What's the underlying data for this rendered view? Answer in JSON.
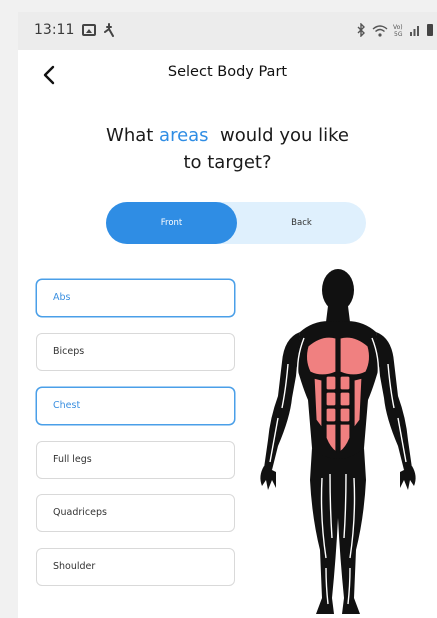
{
  "status_bar": {
    "time": "13:11",
    "left_icons": [
      "gallery-icon",
      "activity-icon"
    ],
    "right_icons": [
      "bluetooth-icon",
      "wifi-icon",
      "volte-icon",
      "signal-icon",
      "battery-icon"
    ],
    "volte_text": "Vo)\n5G"
  },
  "header": {
    "back_icon": "chevron-left-icon",
    "title": "Select Body Part"
  },
  "question": {
    "prefix": "What ",
    "highlight": "areas",
    "suffix_line1": "  would you like",
    "line2": "to target?",
    "highlight_color": "#2f8de4"
  },
  "view_toggle": {
    "options": [
      "Front",
      "Back"
    ],
    "selected": "Front",
    "active_color": "#2f8de4",
    "inactive_color": "#dff0fd"
  },
  "body_parts": [
    {
      "label": "Abs",
      "selected": true
    },
    {
      "label": "Biceps",
      "selected": false
    },
    {
      "label": "Chest",
      "selected": true
    },
    {
      "label": "Full legs",
      "selected": false
    },
    {
      "label": "Quadriceps",
      "selected": false
    },
    {
      "label": "Shoulder",
      "selected": false
    }
  ],
  "figure": {
    "icon": "body-front-icon",
    "highlight_color": "#f08080",
    "highlighted_areas": [
      "Chest",
      "Abs"
    ]
  }
}
